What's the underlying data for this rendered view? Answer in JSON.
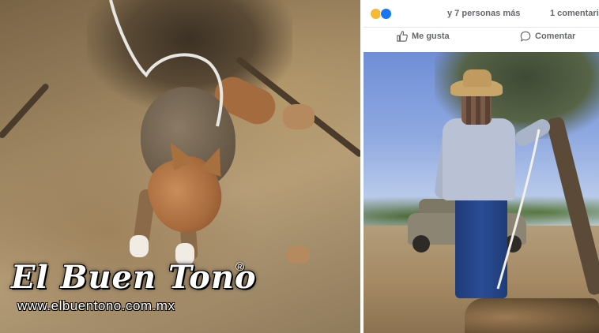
{
  "watermark": {
    "brand": "El Buen Tono",
    "registered_mark": "®",
    "url": "www.elbuentono.com.mx"
  },
  "facebook_post": {
    "reactions": {
      "icons": [
        "wow-reaction-icon",
        "like-reaction-icon"
      ],
      "people_text": "y 7 personas más",
      "comments_text": "1 comentari"
    },
    "actions": {
      "like_label": "Me gusta",
      "comment_label": "Comentar"
    }
  },
  "colors": {
    "facebook_gray": "#65676b",
    "facebook_blue": "#1877f2",
    "wow_yellow": "#f5b935",
    "watermark_text": "#ffffff"
  }
}
